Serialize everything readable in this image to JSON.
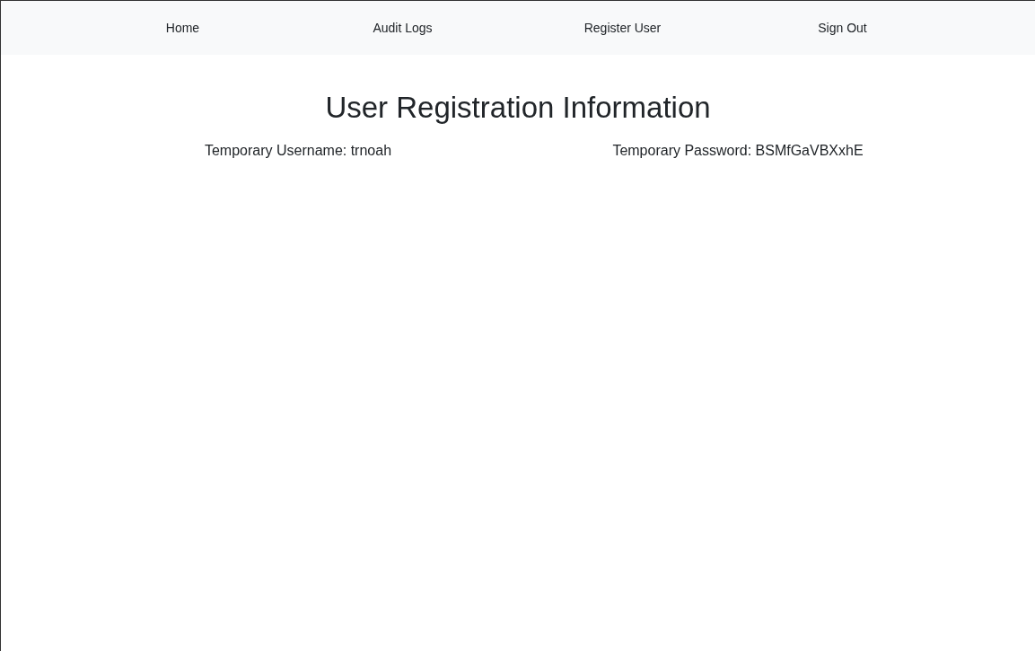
{
  "nav": {
    "items": [
      {
        "label": "Home"
      },
      {
        "label": "Audit Logs"
      },
      {
        "label": "Register User"
      },
      {
        "label": "Sign Out"
      }
    ]
  },
  "heading": "User Registration Information",
  "details": [
    {
      "text": "Temporary Username: trnoah"
    },
    {
      "text": "Temporary Password: BSMfGaVBXxhE"
    }
  ]
}
